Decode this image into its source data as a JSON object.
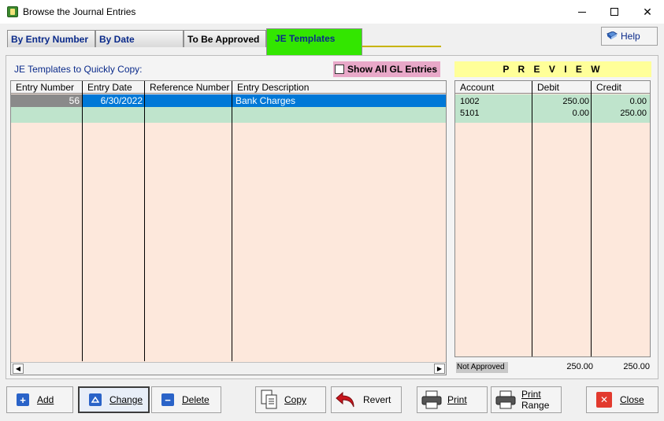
{
  "window": {
    "title": "Browse the Journal Entries"
  },
  "tabs": [
    {
      "label": "By Entry Number"
    },
    {
      "label": "By Date"
    },
    {
      "label": "To Be Approved"
    },
    {
      "label": "JE Templates"
    }
  ],
  "help_label": "Help",
  "templates_label": "JE Templates to Quickly Copy:",
  "show_all_label": "Show All GL Entries",
  "grid": {
    "columns": [
      "Entry Number",
      "Entry Date",
      "Reference Number",
      "Entry Description"
    ],
    "rows": [
      {
        "entry_number": "56",
        "entry_date": "6/30/2022",
        "reference_number": "",
        "description": "Bank Charges"
      }
    ]
  },
  "preview": {
    "title": "P R E V I E W",
    "columns": [
      "Account",
      "Debit",
      "Credit"
    ],
    "rows": [
      {
        "account": "1002",
        "debit": "250.00",
        "credit": "0.00"
      },
      {
        "account": "5101",
        "debit": "0.00",
        "credit": "250.00"
      }
    ],
    "status": "Not Approved",
    "total_debit": "250.00",
    "total_credit": "250.00"
  },
  "buttons": {
    "add": "Add",
    "change": "Change",
    "delete": "Delete",
    "copy": "Copy",
    "revert": "Revert",
    "print": "Print",
    "print_range_1": "Print",
    "print_range_2": "Range",
    "close": "Close"
  },
  "colors": {
    "active_tab": "#33e600",
    "grid_bg": "#fde8dc",
    "selection": "#0078d7",
    "green_row": "#bfe4cc",
    "preview_header": "#ffff99",
    "show_all_bg": "#e8a8c8"
  }
}
